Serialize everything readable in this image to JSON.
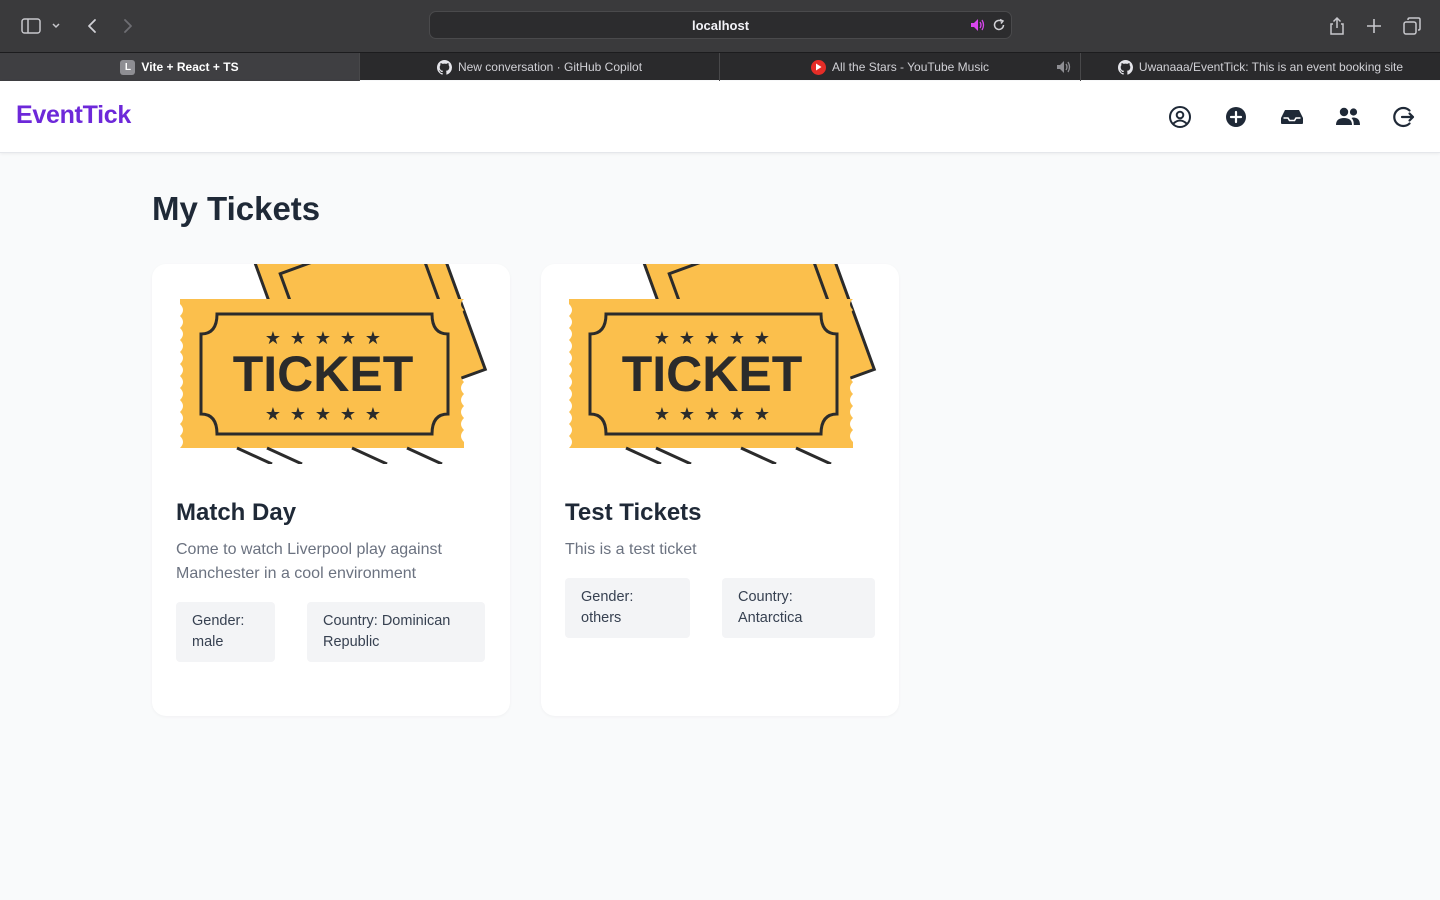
{
  "browser": {
    "url": "localhost",
    "tabs": [
      {
        "label": "Vite + React + TS",
        "favicon": "L"
      },
      {
        "label": "New conversation · GitHub Copilot"
      },
      {
        "label": "All the Stars - YouTube Music"
      },
      {
        "label": "Uwanaaa/EventTick: This is an event booking site"
      }
    ]
  },
  "app": {
    "logo": "EventTick",
    "nav_icons": [
      "profile-icon",
      "add-event-icon",
      "inbox-icon",
      "users-icon",
      "logout-icon"
    ]
  },
  "page": {
    "title": "My Tickets"
  },
  "tickets": [
    {
      "image_text": "TICKET",
      "title": "Match Day",
      "description": "Come to watch Liverpool play against Manchester in a cool environment",
      "gender": "Gender: male",
      "country": "Country: Dominican Republic"
    },
    {
      "image_text": "TICKET",
      "title": "Test Tickets",
      "description": "This is a test ticket",
      "gender": "Gender: others",
      "country": "Country: Antarctica"
    }
  ],
  "colors": {
    "brand": "#6d28d9",
    "ticket_gold": "#fbbf4c",
    "ticket_ink": "#2b2b2b"
  }
}
